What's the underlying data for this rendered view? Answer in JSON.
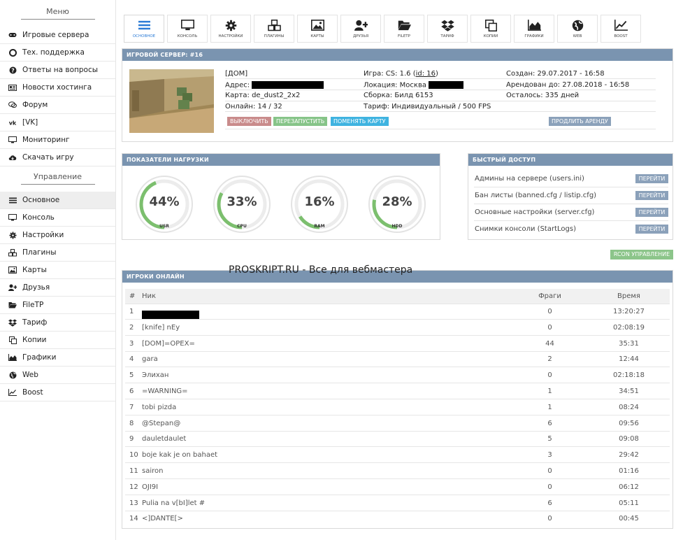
{
  "sidebar": {
    "menu_title": "Меню",
    "menu_items": [
      {
        "label": "Игровые сервера",
        "icon": "gamepad-icon"
      },
      {
        "label": "Тех. поддержка",
        "icon": "lifebuoy-icon"
      },
      {
        "label": "Ответы на вопросы",
        "icon": "question-icon"
      },
      {
        "label": "Новости хостинга",
        "icon": "newspaper-icon"
      },
      {
        "label": "Форум",
        "icon": "chat-icon"
      },
      {
        "label": "[VK]",
        "icon": "vk-icon"
      },
      {
        "label": "Мониторинг",
        "icon": "monitor-icon"
      },
      {
        "label": "Скачать игру",
        "icon": "cloud-download-icon"
      }
    ],
    "manage_title": "Управление",
    "manage_items": [
      {
        "label": "Основное",
        "icon": "bars-icon",
        "active": true
      },
      {
        "label": "Консоль",
        "icon": "desktop-icon"
      },
      {
        "label": "Настройки",
        "icon": "gear-icon"
      },
      {
        "label": "Плагины",
        "icon": "cubes-icon"
      },
      {
        "label": "Карты",
        "icon": "image-icon"
      },
      {
        "label": "Друзья",
        "icon": "user-plus-icon"
      },
      {
        "label": "FileTP",
        "icon": "folder-open-icon"
      },
      {
        "label": "Тариф",
        "icon": "dropbox-icon"
      },
      {
        "label": "Копии",
        "icon": "copy-icon"
      },
      {
        "label": "Графики",
        "icon": "area-chart-icon"
      },
      {
        "label": "Web",
        "icon": "globe-icon"
      },
      {
        "label": "Boost",
        "icon": "line-chart-icon"
      }
    ]
  },
  "toolbar": [
    {
      "label": "Основное",
      "icon": "bars-icon",
      "active": true
    },
    {
      "label": "Консоль",
      "icon": "desktop-icon"
    },
    {
      "label": "Настройки",
      "icon": "gear-icon"
    },
    {
      "label": "Плагины",
      "icon": "cubes-icon"
    },
    {
      "label": "Карты",
      "icon": "image-icon"
    },
    {
      "label": "Друзья",
      "icon": "user-plus-icon"
    },
    {
      "label": "FileTP",
      "icon": "folder-open-icon"
    },
    {
      "label": "Тариф",
      "icon": "dropbox-icon"
    },
    {
      "label": "Копии",
      "icon": "copy-icon"
    },
    {
      "label": "Графики",
      "icon": "area-chart-icon"
    },
    {
      "label": "Web",
      "icon": "globe-icon"
    },
    {
      "label": "Boost",
      "icon": "line-chart-icon"
    }
  ],
  "server": {
    "title": "Игровой сервер: #16",
    "name": "[ДОМ]",
    "address_label": "Адрес:",
    "map": "Карта: de_dust2_2x2",
    "online": "Онлайн: 14 / 32",
    "game_prefix": "Игра: CS: 1.6 (",
    "game_id": "id: 16",
    "game_suffix": ")",
    "location_label": "Локация: Москва",
    "build": "Сборка: Билд 6153",
    "tariff": "Тариф: Индивидуальный / 500 FPS",
    "created": "Создан: 29.07.2017 - 16:58",
    "rented_until": "Арендован до: 27.08.2018 - 16:58",
    "remaining": "Осталось: 335 дней",
    "buttons": {
      "stop": "Выключить",
      "restart": "Перезапустить",
      "change_map": "Поменять карту",
      "extend": "Продлить аренду"
    }
  },
  "load": {
    "title": "Показатели нагрузки",
    "gauges": [
      {
        "label": "USR",
        "pct_text": "44%",
        "value": 44
      },
      {
        "label": "CPU",
        "pct_text": "33%",
        "value": 33
      },
      {
        "label": "RAM",
        "pct_text": "16%",
        "value": 16
      },
      {
        "label": "HDD",
        "pct_text": "28%",
        "value": 28
      }
    ]
  },
  "quick": {
    "title": "Быстрый доступ",
    "rows": [
      {
        "text": "Админы на сервере (users.ini)",
        "button": "Перейти"
      },
      {
        "text": "Бан листы (banned.cfg / listip.cfg)",
        "button": "Перейти"
      },
      {
        "text": "Основные настройки (server.cfg)",
        "button": "Перейти"
      },
      {
        "text": "Снимки консоли (StartLogs)",
        "button": "Перейти"
      }
    ]
  },
  "rcon_button": "RCON управление",
  "watermark": "PROSKRIPT.RU - Все для вебмастера",
  "players": {
    "title": "Игроки онлайн",
    "headers": {
      "num": "#",
      "nick": "Ник",
      "frags": "Фраги",
      "time": "Время"
    },
    "rows": [
      {
        "num": "1",
        "nick": "",
        "redacted": true,
        "frags": "0",
        "time": "13:20:27"
      },
      {
        "num": "2",
        "nick": "[knife] nEy",
        "frags": "0",
        "time": "02:08:19"
      },
      {
        "num": "3",
        "nick": "[DOM]=OPEX=",
        "frags": "44",
        "time": "35:31"
      },
      {
        "num": "4",
        "nick": "gara",
        "frags": "2",
        "time": "12:44"
      },
      {
        "num": "5",
        "nick": "Элихан",
        "frags": "0",
        "time": "02:18:18"
      },
      {
        "num": "6",
        "nick": "=WARNING=",
        "frags": "1",
        "time": "34:51"
      },
      {
        "num": "7",
        "nick": "tobi pizda",
        "frags": "1",
        "time": "08:24"
      },
      {
        "num": "8",
        "nick": "@Stepan@",
        "frags": "6",
        "time": "09:56"
      },
      {
        "num": "9",
        "nick": "dauletdaulet",
        "frags": "5",
        "time": "09:08"
      },
      {
        "num": "10",
        "nick": "boje kak je on bahaet",
        "frags": "3",
        "time": "29:42"
      },
      {
        "num": "11",
        "nick": "sairon",
        "frags": "0",
        "time": "01:16"
      },
      {
        "num": "12",
        "nick": "OJI9I",
        "frags": "0",
        "time": "06:12"
      },
      {
        "num": "13",
        "nick": "Pulia na v[bI]let #",
        "frags": "6",
        "time": "05:11"
      },
      {
        "num": "14",
        "nick": "<]DANTE[>",
        "frags": "0",
        "time": "00:45"
      }
    ]
  },
  "colors": {
    "panel_header": "#7a94b0",
    "accent_blue": "#2b7bd6",
    "gauge_green": "#7cbf6e",
    "btn_stop": "#c98b8b",
    "btn_restart": "#86c488",
    "btn_change_map": "#3fb3e0",
    "btn_extend": "#8ba1ba",
    "btn_rcon": "#8cc58a"
  }
}
